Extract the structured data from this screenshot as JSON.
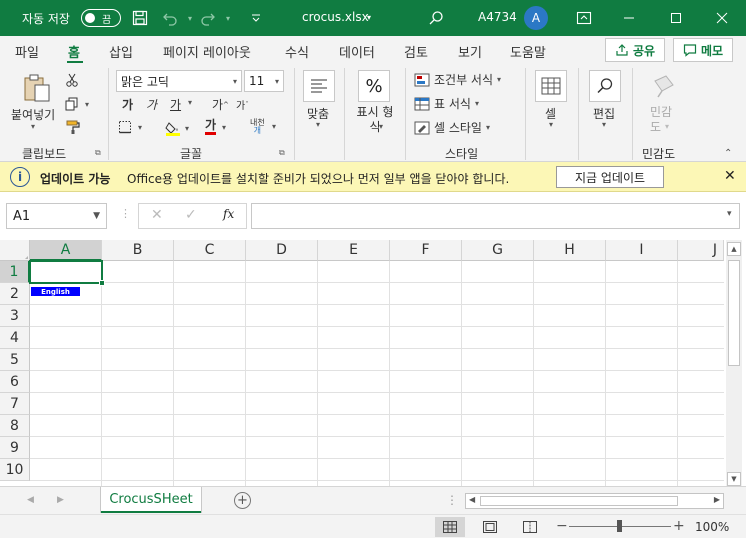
{
  "titlebar": {
    "autosave_label": "자동 저장",
    "autosave_state": "끔",
    "filename": "crocus.xlsx",
    "cell_ref": "A4734",
    "user_initial": "A"
  },
  "tabs": [
    "파일",
    "홈",
    "삽입",
    "페이지 레이아웃",
    "수식",
    "데이터",
    "검토",
    "보기",
    "도움말"
  ],
  "share_label": "공유",
  "memo_label": "메모",
  "ribbon": {
    "paste_label": "붙여넣기",
    "clipboard_label": "클립보드",
    "font_name": "맑은 고딕",
    "font_size": "11",
    "font_group_label": "글꼴",
    "font_bold": "가",
    "font_italic": "가",
    "font_underline": "가",
    "font_grow": "가",
    "font_shrink": "가",
    "font_color_glyph": "가",
    "phonetic_label": "내천",
    "align_label": "맞춤",
    "number_label": "표시 형식",
    "percent_glyph": "%",
    "cond_format_label": "조건부 서식",
    "table_format_label": "표 서식",
    "cell_style_label": "셀 스타일",
    "style_group_label": "스타일",
    "cells_label": "셀",
    "edit_label": "편집",
    "sensitivity_label": "민감도",
    "sensitivity_group_label": "민감도"
  },
  "infobar": {
    "title": "업데이트 가능",
    "message": "Office용 업데이트를 설치할 준비가 되었으나 먼저 일부 앱을 닫아야 합니다.",
    "button": "지금 업데이트"
  },
  "formula": {
    "name_box": "A1",
    "fx": "fx",
    "value": ""
  },
  "columns": [
    "A",
    "B",
    "C",
    "D",
    "E",
    "F",
    "G",
    "H",
    "I",
    "J"
  ],
  "rows": [
    "1",
    "2",
    "3",
    "4",
    "5",
    "6",
    "7",
    "8",
    "9",
    "10"
  ],
  "cells": {
    "A2": "English"
  },
  "sheet_tab": "CrocusSHeet",
  "zoom": "100%",
  "colors": {
    "accent": "#107c41",
    "info_bg": "#fcf7b6",
    "english_cell_bg": "#0000ff"
  }
}
